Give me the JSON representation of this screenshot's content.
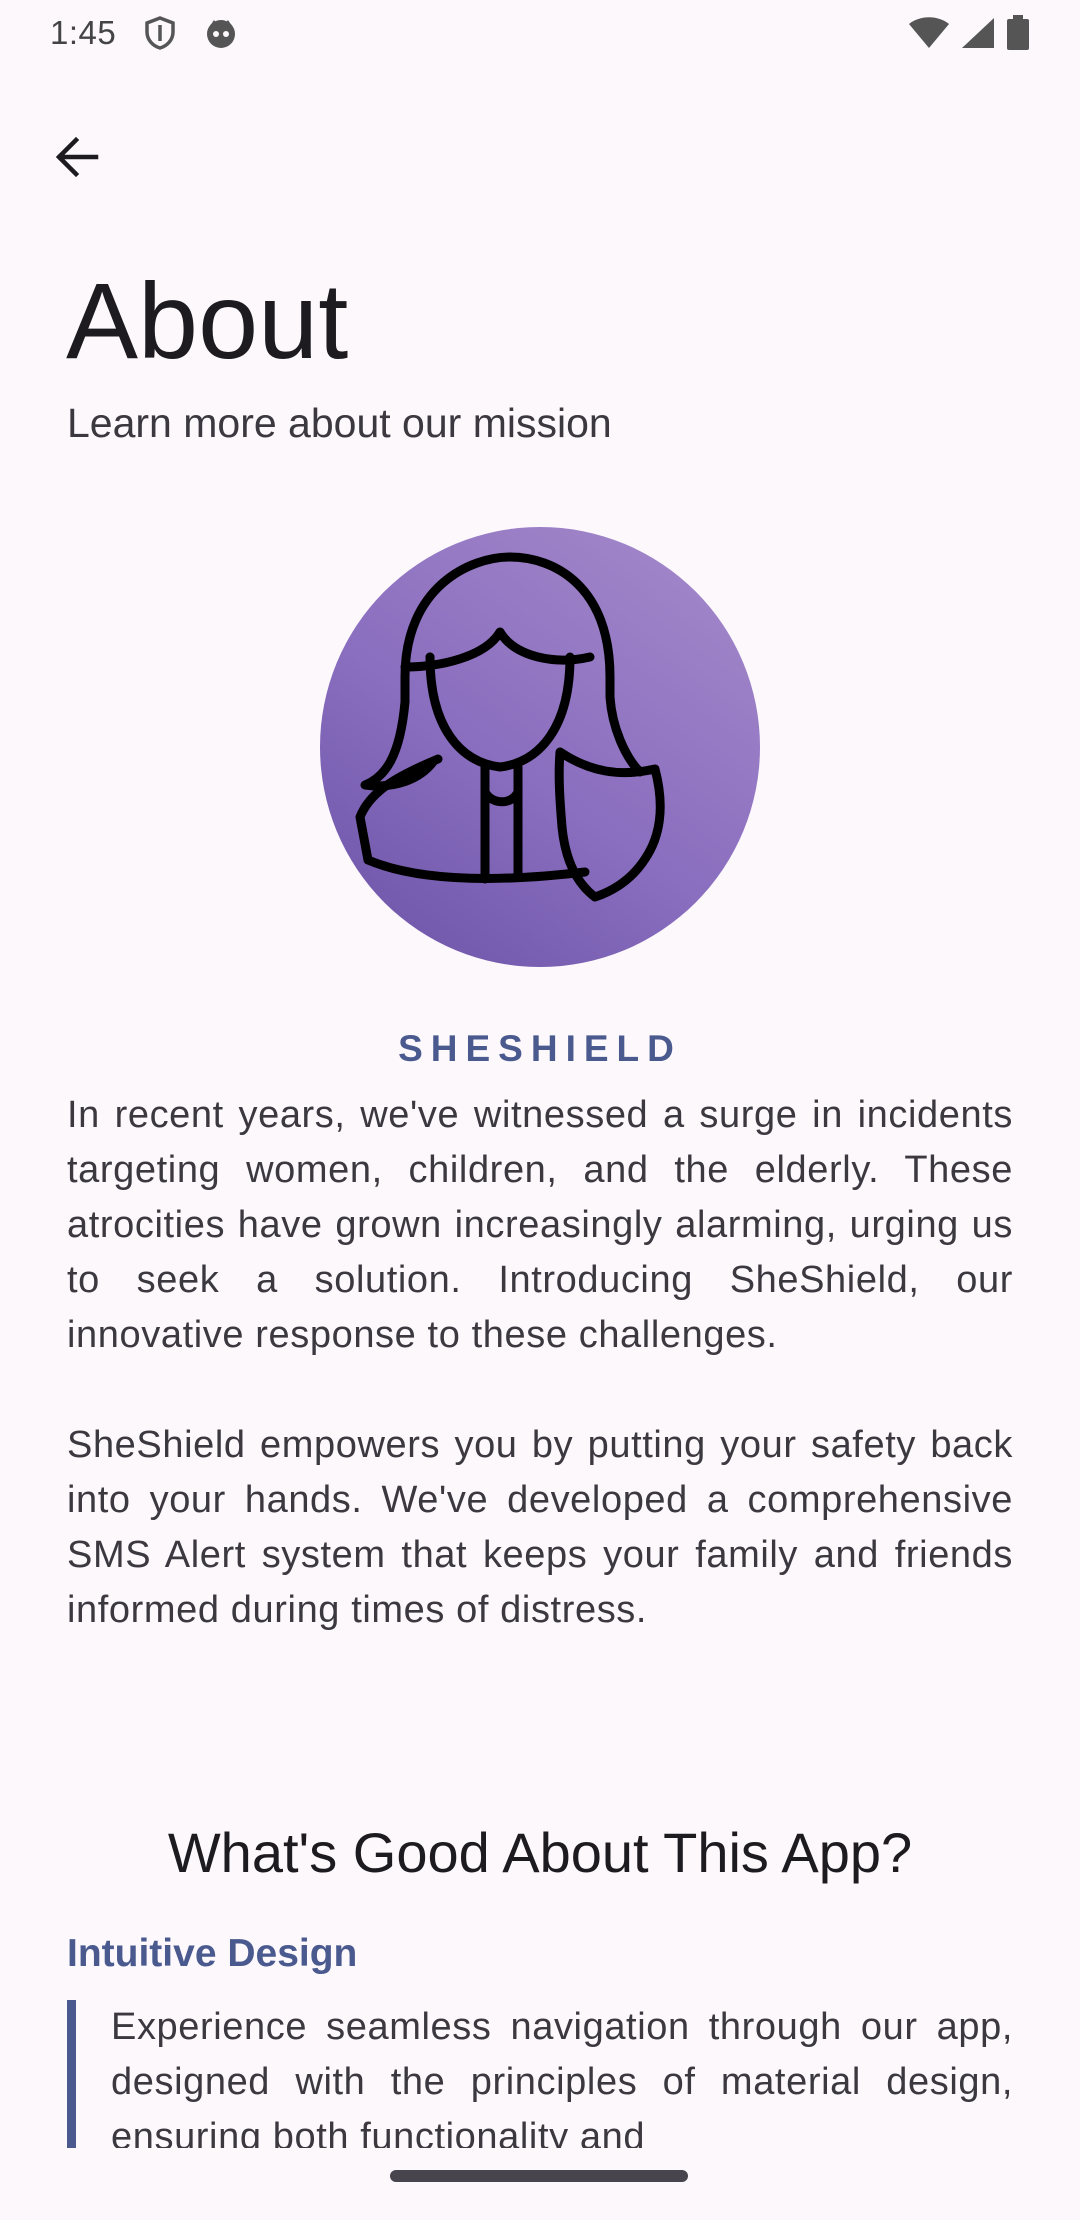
{
  "status_bar": {
    "time": "1:45",
    "left_icons": [
      "shield-status-icon",
      "face-status-icon"
    ],
    "right_icons": [
      "wifi-icon",
      "signal-icon",
      "battery-icon"
    ]
  },
  "header": {
    "title": "About",
    "subtitle": "Learn more about our mission"
  },
  "avatar": {
    "icon": "woman-shield-icon",
    "gradient": [
      "#6a52a6",
      "#a68bcb"
    ]
  },
  "brand": {
    "name": "SHESHIELD",
    "color": "#4a5a8f"
  },
  "paragraphs": [
    "In recent years, we've witnessed a surge in incidents targeting women, children, and the elderly. These atrocities have grown increasingly alarming, urging us to seek a solution. Introducing SheShield, our innovative response to these challenges.",
    "SheShield empowers you by putting your safety back into your hands. We've developed a comprehensive SMS Alert system that keeps your family and friends informed during times of distress."
  ],
  "features": {
    "heading": "What's Good About This App?",
    "items": [
      {
        "title": "Intuitive Design",
        "text": "Experience seamless navigation through our app, designed with the principles of material design, ensuring both functionality and"
      }
    ]
  }
}
